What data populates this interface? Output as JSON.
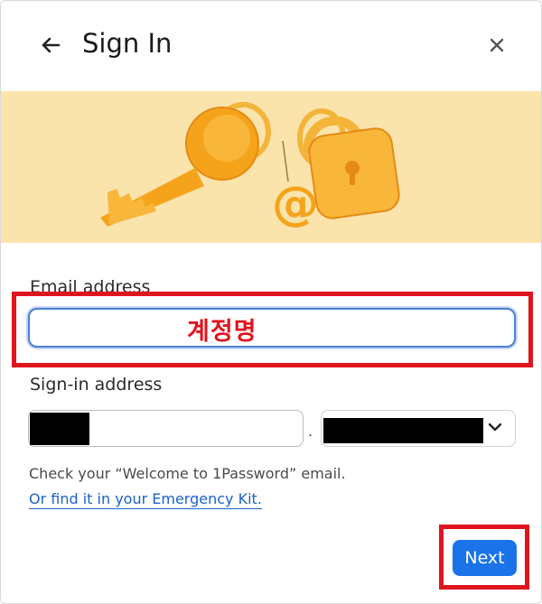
{
  "header": {
    "title": "Sign In",
    "back_icon": "arrow-left-icon",
    "close_icon": "close-icon"
  },
  "banner": {
    "illustration": "key-and-padlock-illustration",
    "background_color": "#fbe3ac"
  },
  "form": {
    "email_label": "Email address",
    "email_value": "",
    "email_annotation": "계정명",
    "signin_label": "Sign-in address",
    "signin_separator": ".",
    "domain_select_icon": "chevron-down-icon",
    "help_text": "Check your “Welcome to 1Password” email.",
    "kit_link": "Or find it in your Emergency Kit."
  },
  "footer": {
    "next_label": "Next",
    "accent_color": "#1a73e8"
  },
  "annotations": {
    "highlight_color": "#e0141e"
  }
}
